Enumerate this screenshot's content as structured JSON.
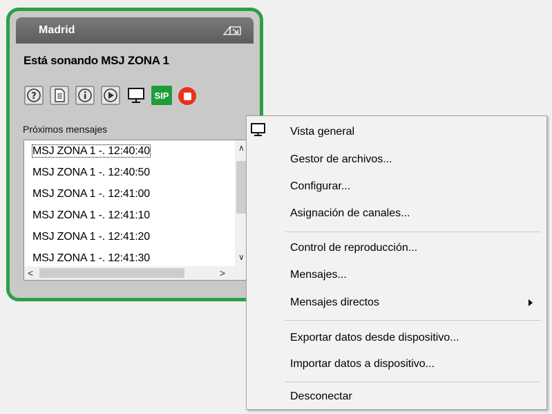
{
  "device": {
    "title": "Madrid",
    "status": "Está sonando MSJ ZONA 1",
    "toolbar": {
      "sip_label": "SIP"
    },
    "next_messages_label": "Próximos mensajes",
    "messages": [
      "MSJ ZONA 1 -. 12:40:40",
      "MSJ ZONA 1 -. 12:40:50",
      "MSJ ZONA 1 -. 12:41:00",
      "MSJ ZONA 1 -. 12:41:10",
      "MSJ ZONA 1 -. 12:41:20",
      "MSJ ZONA 1 -. 12:41:30"
    ],
    "border_color": "#2c9f45"
  },
  "menu": {
    "items": [
      {
        "label": "Vista general",
        "icon": "monitor-icon"
      },
      {
        "label": "Gestor de archivos..."
      },
      {
        "label": "Configurar..."
      },
      {
        "label": "Asignación de canales..."
      },
      {
        "label": "Control de reproducción..."
      },
      {
        "label": "Mensajes..."
      },
      {
        "label": "Mensajes directos",
        "submenu": true
      },
      {
        "label": "Exportar datos desde dispositivo..."
      },
      {
        "label": "Importar datos a dispositivo..."
      },
      {
        "label": "Desconectar"
      }
    ]
  }
}
